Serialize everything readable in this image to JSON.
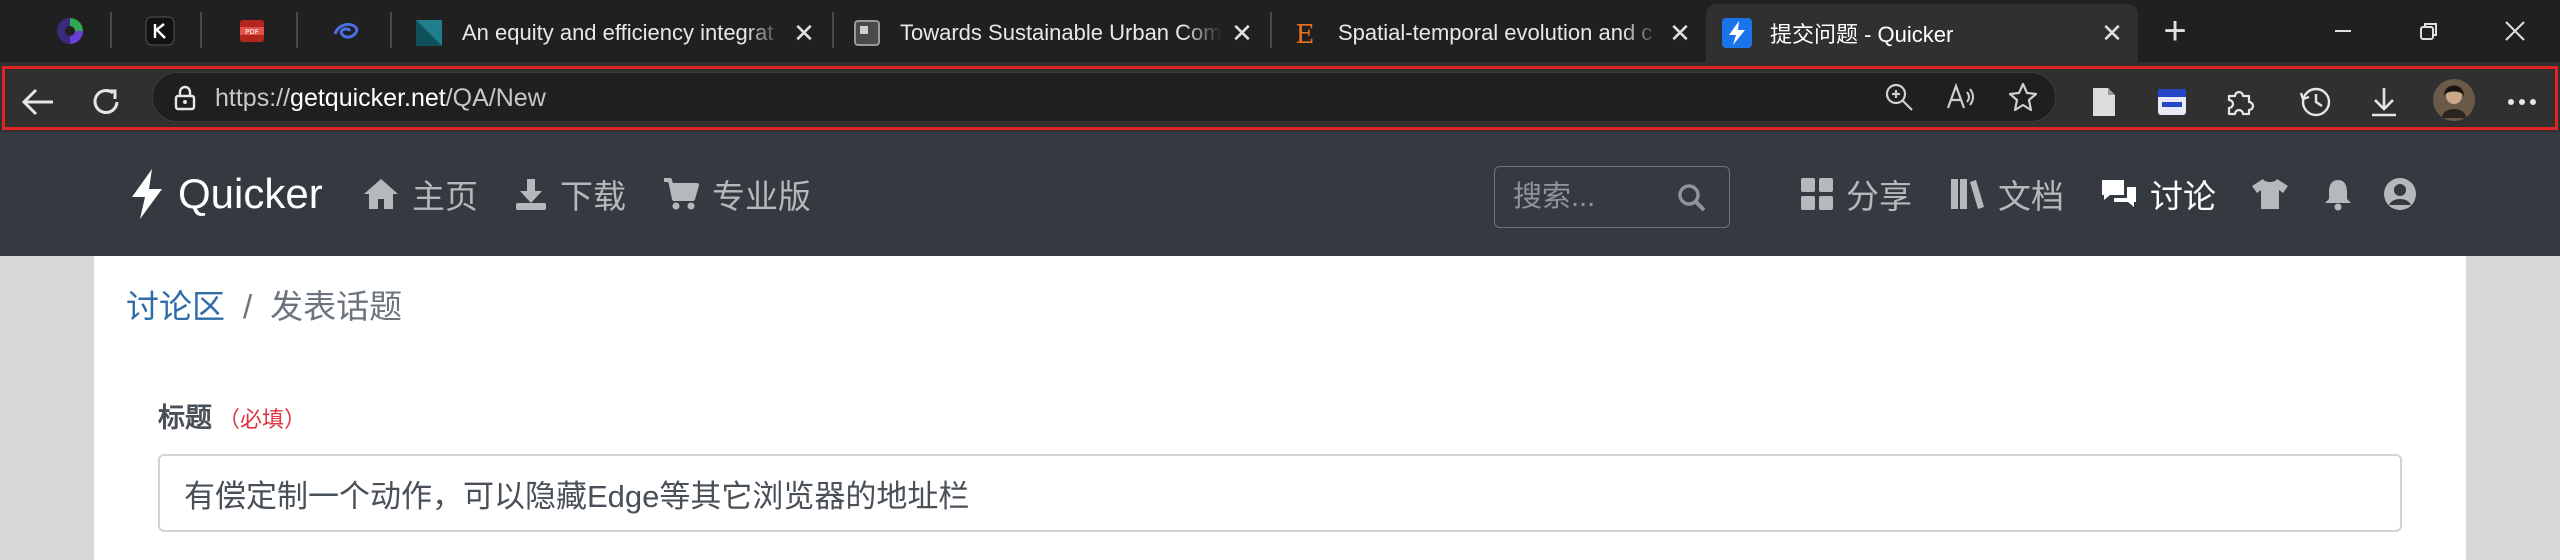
{
  "tabs": [
    {
      "title": "An equity and efficiency integrat"
    },
    {
      "title": "Towards Sustainable Urban Com"
    },
    {
      "title": "Spatial-temporal evolution and c"
    },
    {
      "title": "提交问题 - Quicker"
    }
  ],
  "address_bar": {
    "url_prefix": "https://",
    "url_host": "getquicker.net",
    "url_path": "/QA/New"
  },
  "site": {
    "brand": "Quicker",
    "nav": {
      "home": "主页",
      "download": "下载",
      "pro": "专业版",
      "share": "分享",
      "docs": "文档",
      "discuss": "讨论"
    },
    "search_placeholder": "搜索..."
  },
  "breadcrumb": {
    "parent": "讨论区",
    "separator": "/",
    "current": "发表话题"
  },
  "form": {
    "title_label": "标题",
    "title_required": "（必填）",
    "title_value": "有偿定制一个动作，可以隐藏Edge等其它浏览器的地址栏"
  },
  "colors": {
    "accent_active_tab_icon": "#1a73e8",
    "highlight_outline": "#e02424",
    "navbar": "#343a40",
    "link": "#2f6da8",
    "required": "#dc3545"
  }
}
